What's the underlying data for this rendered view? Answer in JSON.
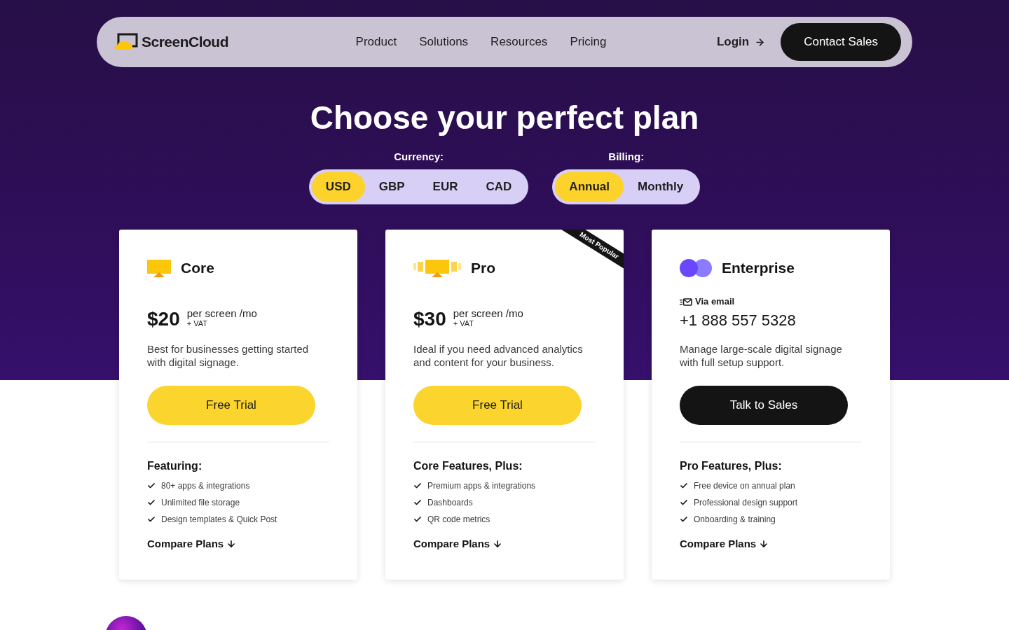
{
  "nav": {
    "logo": "ScreenCloud",
    "links": [
      "Product",
      "Solutions",
      "Resources",
      "Pricing"
    ],
    "login": "Login",
    "cta": "Contact Sales"
  },
  "heading": "Choose your perfect plan",
  "currency": {
    "label": "Currency:",
    "options": [
      {
        "label": "USD",
        "selected": true
      },
      {
        "label": "GBP",
        "selected": false
      },
      {
        "label": "EUR",
        "selected": false
      },
      {
        "label": "CAD",
        "selected": false
      }
    ]
  },
  "billing": {
    "label": "Billing:",
    "options": [
      {
        "label": "Annual",
        "selected": true
      },
      {
        "label": "Monthly",
        "selected": false
      }
    ]
  },
  "plans": [
    {
      "kind": "core",
      "name": "Core",
      "price": "$20",
      "unit": "per screen /mo",
      "tax": "+ VAT",
      "description": "Best for businesses getting started with digital signage.",
      "button": {
        "label": "Free Trial",
        "kind": "primary"
      },
      "features_title": "Featuring:",
      "features": [
        "80+ apps & integrations",
        "Unlimited file storage",
        "Design templates & Quick Post"
      ],
      "compare": "Compare Plans"
    },
    {
      "kind": "pro",
      "name": "Pro",
      "ribbon": "Most Popular",
      "price": "$30",
      "unit": "per screen /mo",
      "tax": "+ VAT",
      "description": "Ideal if you need advanced analytics and content for your business.",
      "button": {
        "label": "Free Trial",
        "kind": "primary"
      },
      "features_title": "Core Features, Plus:",
      "features": [
        "Premium apps & integrations",
        "Dashboards",
        "QR code metrics"
      ],
      "compare": "Compare Plans"
    },
    {
      "kind": "enterprise",
      "name": "Enterprise",
      "contact_label": "Via email",
      "phone": "+1 888 557 5328",
      "description": "Manage large-scale digital signage with full setup support.",
      "button": {
        "label": "Talk to Sales",
        "kind": "dark"
      },
      "features_title": "Pro Features, Plus:",
      "features": [
        "Free device on annual plan",
        "Professional design support",
        "Onboarding & training"
      ],
      "compare": "Compare Plans"
    }
  ]
}
